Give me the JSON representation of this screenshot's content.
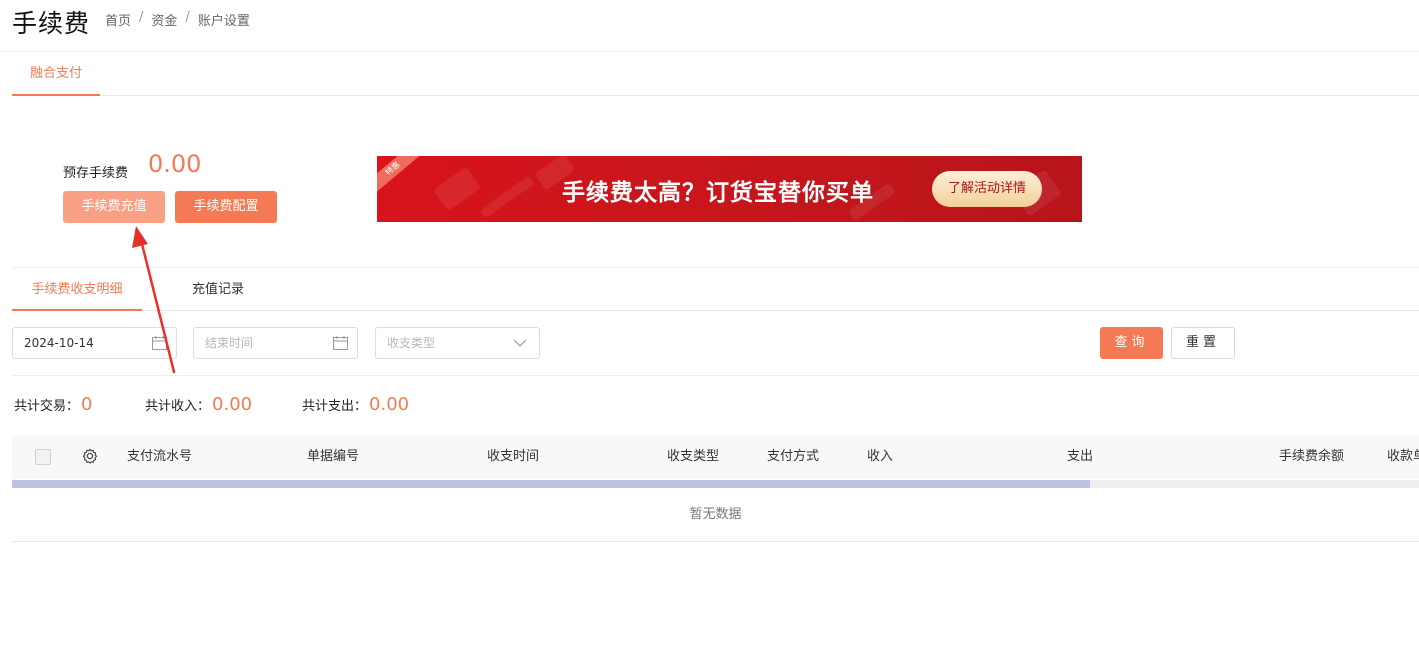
{
  "header": {
    "title": "手续费",
    "breadcrumb": [
      "首页",
      "资金",
      "账户设置"
    ],
    "breadcrumb_sep": "/"
  },
  "tabs_primary": [
    {
      "label": "融合支付",
      "active": true
    }
  ],
  "fee": {
    "label": "预存手续费",
    "amount": "0.00",
    "recharge_button": "手续费充值",
    "config_button": "手续费配置"
  },
  "banner": {
    "corner_tag": "特惠",
    "headline": "手续费太高？订货宝替你买单",
    "cta": "了解活动详情"
  },
  "tabs_secondary": [
    {
      "label": "手续费收支明细",
      "active": true
    },
    {
      "label": "充值记录",
      "active": false
    }
  ],
  "filters": {
    "start_date": "2024-10-14",
    "end_placeholder": "结束时间",
    "type_placeholder": "收支类型",
    "query_button": "查询",
    "reset_button": "重置"
  },
  "summary": {
    "transactions_label": "共计交易：",
    "transactions_value": "0",
    "income_label": "共计收入：",
    "income_value": "0.00",
    "expense_label": "共计支出：",
    "expense_value": "0.00"
  },
  "table": {
    "columns": [
      "支付流水号",
      "单据编号",
      "收支时间",
      "收支类型",
      "支付方式",
      "收入",
      "支出",
      "手续费余额",
      "收款单"
    ],
    "empty_text": "暂无数据"
  },
  "colors": {
    "accent": "#f47a55",
    "accent_light": "#f9a085",
    "banner_red": "#d8141b",
    "annotation_arrow": "#e8302a"
  }
}
